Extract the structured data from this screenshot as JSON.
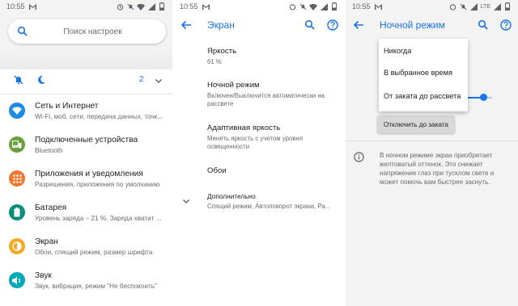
{
  "status": {
    "time": "10:55",
    "network_p3": "LTE"
  },
  "main_settings": {
    "search_placeholder": "Поиск настроек",
    "conditions_count": "2",
    "items": [
      {
        "title": "Сеть и Интернет",
        "subtitle": "Wi-Fi, моб. сети, передача данных, точк...",
        "icon": "wifi-icon",
        "color": "#1e88e5"
      },
      {
        "title": "Подключенные устройства",
        "subtitle": "Bluetooth",
        "icon": "devices-icon",
        "color": "#689f38"
      },
      {
        "title": "Приложения и уведомления",
        "subtitle": "Разрешения, приложения по умолчанию",
        "icon": "apps-icon",
        "color": "#f4762d"
      },
      {
        "title": "Батарея",
        "subtitle": "Уровень заряда – 21 %. Заряда хватит ...",
        "icon": "battery-icon",
        "color": "#0d8f7d"
      },
      {
        "title": "Экран",
        "subtitle": "Обои, спящий режим, размер шрифта",
        "icon": "display-icon",
        "color": "#f9a825"
      },
      {
        "title": "Звук",
        "subtitle": "Звук, вибрация, режим \"Не беспокоить\"",
        "icon": "sound-icon",
        "color": "#00a9b8"
      }
    ]
  },
  "display_screen": {
    "title": "Экран",
    "settings": [
      {
        "title": "Яркость",
        "subtitle": "61 %"
      },
      {
        "title": "Ночной режим",
        "subtitle": "Включен/Выключится автоматически на рассвете"
      },
      {
        "title": "Адаптивная яркость",
        "subtitle": "Менять яркость с учетом уровня освещенности"
      },
      {
        "title": "Обои",
        "subtitle": ""
      },
      {
        "title": "Дополнительно",
        "subtitle": "Спящий режим, Автоповорот экрана, Ра..."
      }
    ]
  },
  "night_mode": {
    "title": "Ночной режим",
    "menu_options": [
      "Никогда",
      "В выбранное время",
      "От заката до рассвета"
    ],
    "action_label": "Отключить до заката",
    "info_text": "В ночном режиме экран приобретает желтоватый оттенок. Это снижает напряжение глаз при тусклом свете и может помочь вам быстрее заснуть."
  },
  "colors": {
    "accent": "#1a73e8"
  }
}
